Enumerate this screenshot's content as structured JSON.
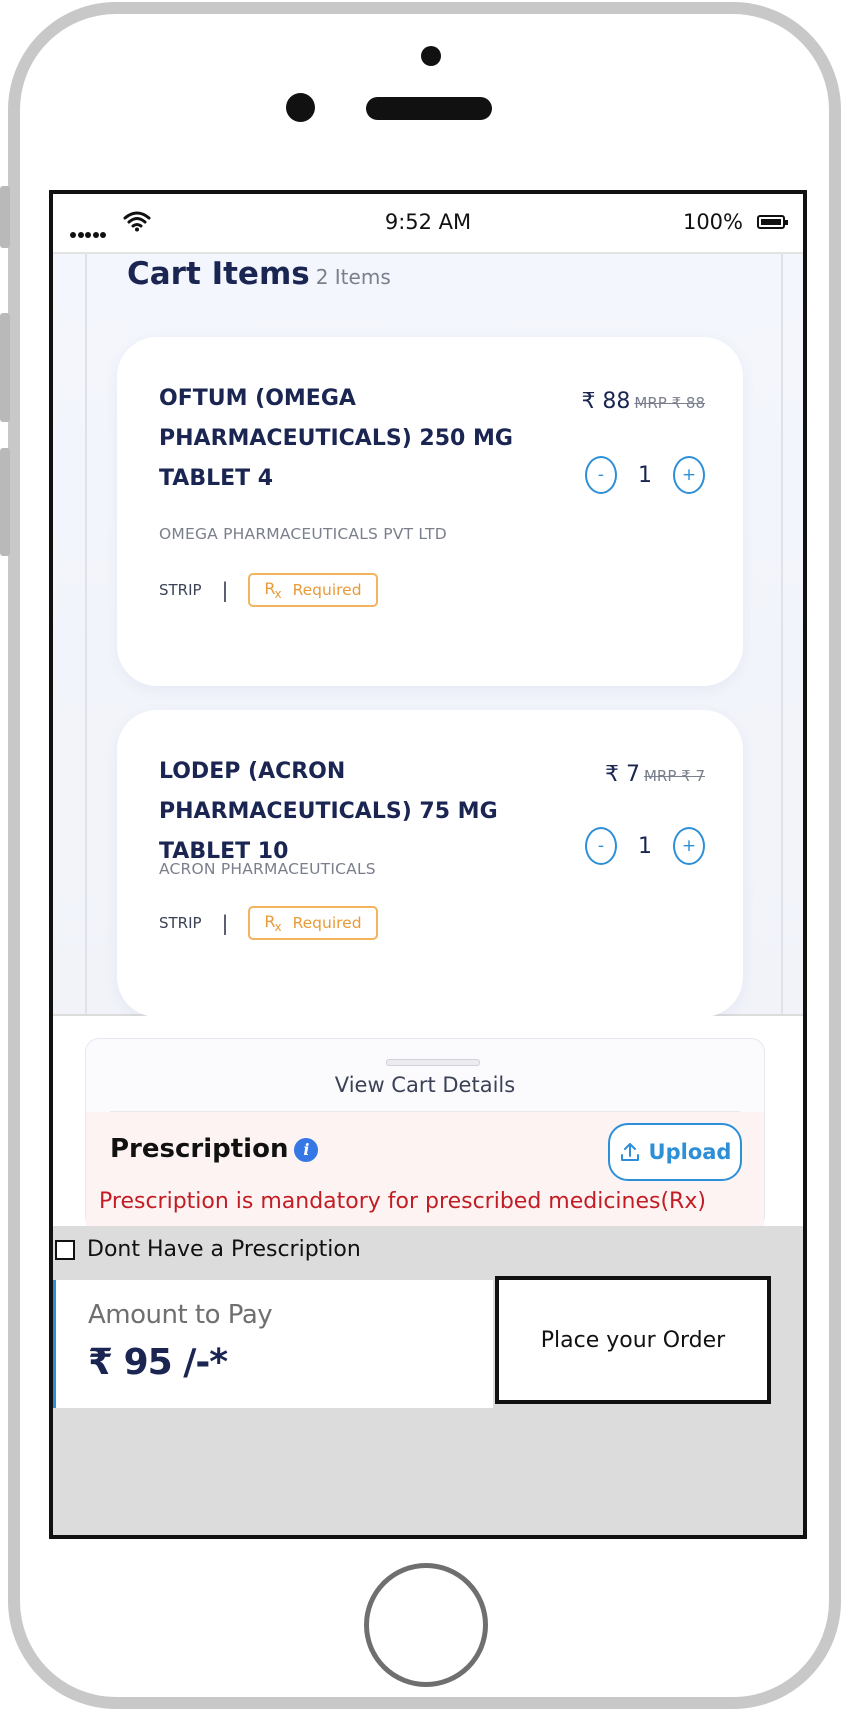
{
  "status_bar": {
    "time": "9:52 AM",
    "battery": "100%"
  },
  "cart": {
    "title": "Cart Items",
    "count_label": "2 Items",
    "items": [
      {
        "name": "OFTUM (OMEGA PHARMACEUTICALS) 250 MG TABLET 4",
        "manufacturer": "OMEGA PHARMACEUTICALS PVT LTD",
        "pack": "STRIP",
        "rx_label": "Required",
        "price": "₹ 88",
        "mrp": "MRP ₹ 88",
        "quantity": "1"
      },
      {
        "name": "LODEP (ACRON PHARMACEUTICALS) 75 MG TABLET 10",
        "manufacturer": "ACRON PHARMACEUTICALS",
        "pack": "STRIP",
        "rx_label": "Required",
        "price": "₹ 7",
        "mrp": "MRP ₹ 7",
        "quantity": "1"
      }
    ],
    "decrement_label": "-",
    "increment_label": "+",
    "separator": "|"
  },
  "sheet": {
    "view_details_label": "View Cart Details",
    "prescription_title": "Prescription",
    "upload_label": "Upload",
    "warning": "Prescription is mandatory for prescribed medicines(Rx)",
    "no_prescription_label": "Dont Have a Prescription"
  },
  "footer": {
    "amount_label": "Amount to Pay",
    "amount_value": "₹ 95 /-*",
    "place_order_label": "Place your Order"
  },
  "colors": {
    "accent": "#2d8fd8",
    "title": "#1a2552",
    "warning": "#c21d24",
    "rx_badge": "#f3b45e"
  }
}
